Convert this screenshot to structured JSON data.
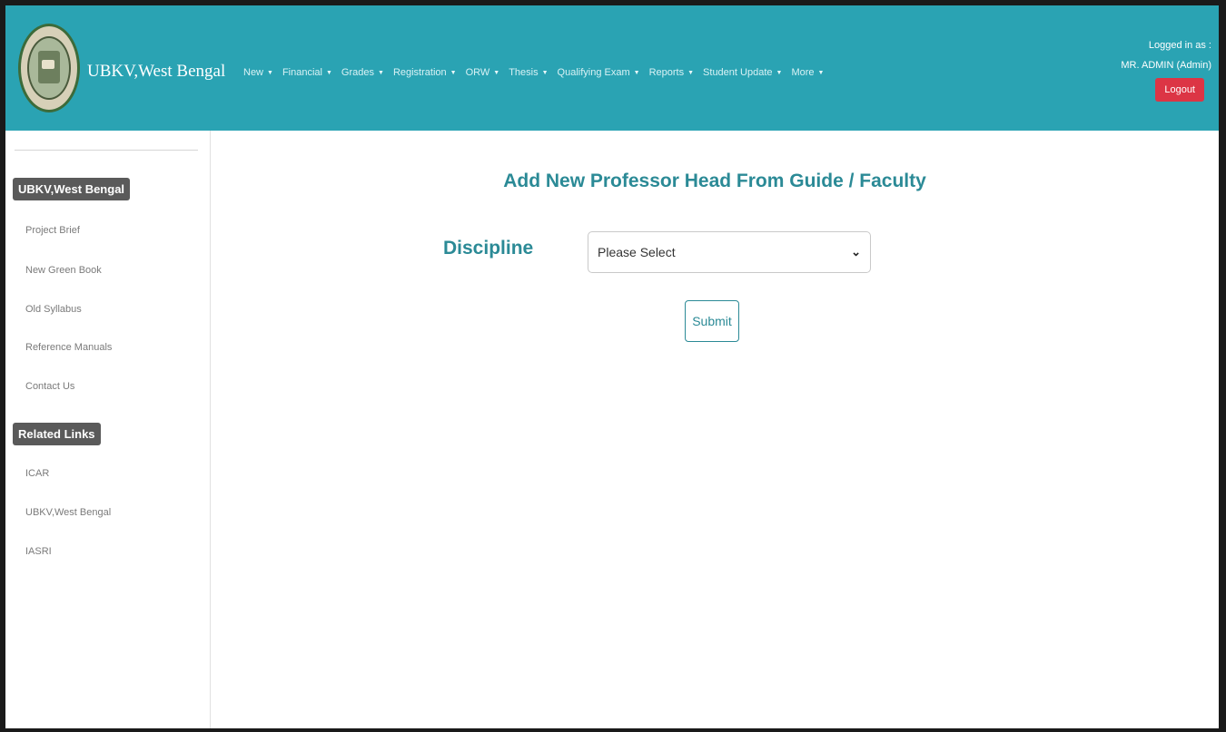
{
  "header": {
    "brand": "UBKV,West Bengal",
    "nav": [
      {
        "label": "New"
      },
      {
        "label": "Financial"
      },
      {
        "label": "Grades"
      },
      {
        "label": "Registration"
      },
      {
        "label": "ORW"
      },
      {
        "label": "Thesis"
      },
      {
        "label": "Qualifying Exam"
      },
      {
        "label": "Reports"
      },
      {
        "label": "Student Update"
      },
      {
        "label": "More"
      }
    ],
    "user": {
      "logged_in_label": "Logged in as :",
      "name": "MR. ADMIN (Admin)",
      "logout_label": "Logout"
    },
    "colors": {
      "bar": "#2aa3b3",
      "logout": "#dc3545"
    }
  },
  "sidebar": {
    "section1_title": "UBKV,West Bengal",
    "section1_links": [
      "Project Brief",
      "New Green Book",
      "Old Syllabus",
      "Reference Manuals",
      "Contact Us"
    ],
    "section2_title": "Related Links",
    "section2_links": [
      "ICAR",
      "UBKV,West Bengal",
      "IASRI"
    ]
  },
  "main": {
    "title": "Add New Professor Head From Guide / Faculty",
    "discipline_label": "Discipline",
    "discipline_value": "Please Select",
    "submit_label": "Submit"
  }
}
